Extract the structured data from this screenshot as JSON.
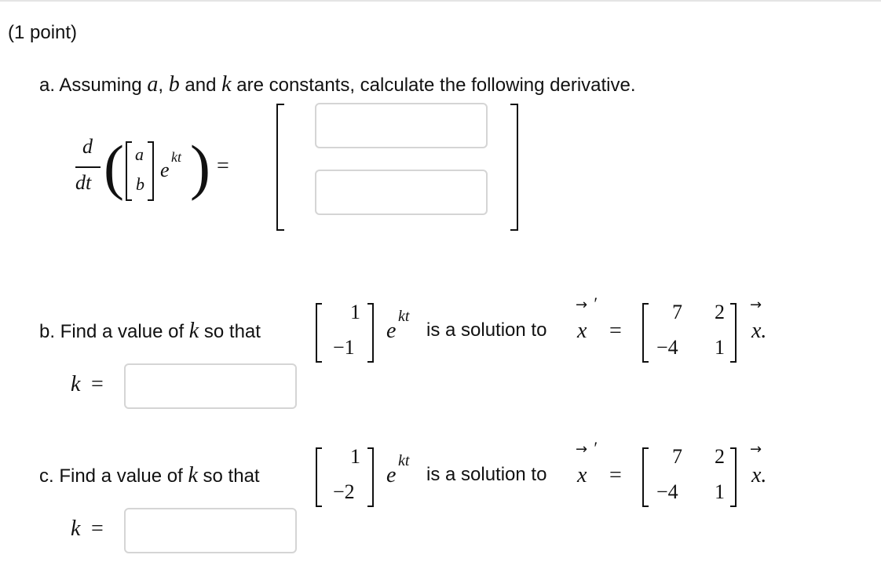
{
  "header": {
    "points": "(1 point)"
  },
  "part_a": {
    "prompt_prefix": "a. Assuming ",
    "var_a": "a",
    "comma": ", ",
    "var_b": "b",
    "and": " and ",
    "var_k": "k",
    "prompt_suffix": " are constants, calculate the following derivative.",
    "d": "d",
    "dt": "dt",
    "vec_top": "a",
    "vec_bottom": "b",
    "exp_e": "e",
    "exp_kt": "kt",
    "equals": "=",
    "answer_top": "",
    "answer_bottom": ""
  },
  "part_b": {
    "prompt": "b. Find a value of ",
    "var_k": "k",
    "so_that": " so that",
    "vec_top": "1",
    "vec_bottom": "−1",
    "exp_e": "e",
    "exp_kt": "kt",
    "is_solution": "is a solution to",
    "x": "x",
    "prime": "′",
    "equals": "=",
    "matrix": [
      "7",
      "2",
      "−4",
      "1"
    ],
    "x_dot": "x.",
    "k_label": "k",
    "k_equals": "=",
    "answer": ""
  },
  "part_c": {
    "prompt": "c. Find a value of ",
    "var_k": "k",
    "so_that": " so that",
    "vec_top": "1",
    "vec_bottom": "−2",
    "exp_e": "e",
    "exp_kt": "kt",
    "is_solution": "is a solution to",
    "x": "x",
    "prime": "′",
    "equals": "=",
    "matrix": [
      "7",
      "2",
      "−4",
      "1"
    ],
    "x_dot": "x.",
    "k_label": "k",
    "k_equals": "=",
    "answer": ""
  },
  "icons": {
    "vector_arrow": "right-arrow-icon"
  }
}
